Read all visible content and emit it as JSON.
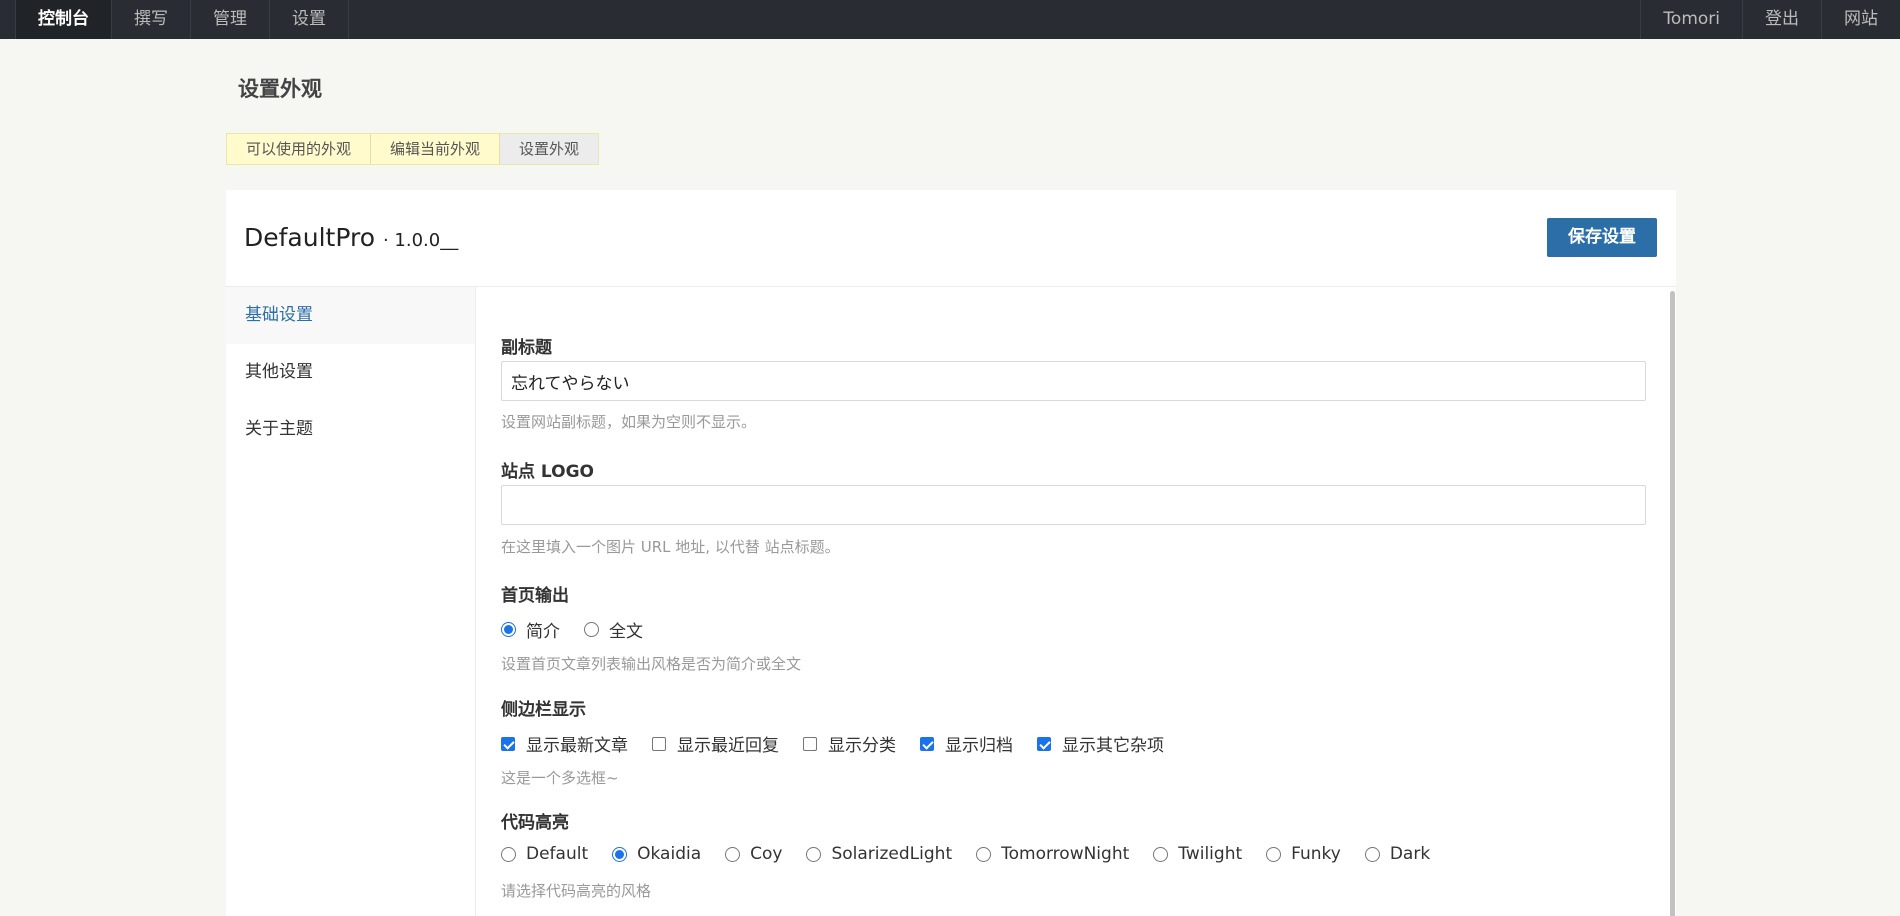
{
  "nav": {
    "left": [
      "控制台",
      "撰写",
      "管理",
      "设置"
    ],
    "right": [
      "Tomori",
      "登出",
      "网站"
    ]
  },
  "page": {
    "title": "设置外观"
  },
  "tabs": [
    "可以使用的外观",
    "编辑当前外观",
    "设置外观"
  ],
  "theme": {
    "name": "DefaultPro",
    "version": "· 1.0.0__"
  },
  "save_label": "保存设置",
  "sidebar": [
    "基础设置",
    "其他设置",
    "关于主题"
  ],
  "fields": {
    "subtitle": {
      "label": "副标题",
      "value": "忘れてやらない",
      "hint": "设置网站副标题，如果为空则不显示。"
    },
    "logo": {
      "label": "站点 LOGO",
      "value": "",
      "hint": "在这里填入一个图片 URL 地址, 以代替 站点标题。"
    },
    "home_output": {
      "label": "首页输出",
      "options": [
        "简介",
        "全文"
      ],
      "selected": "简介",
      "hint": "设置首页文章列表输出风格是否为简介或全文"
    },
    "sidebar_display": {
      "label": "侧边栏显示",
      "options": [
        "显示最新文章",
        "显示最近回复",
        "显示分类",
        "显示归档",
        "显示其它杂项"
      ],
      "checked": [
        true,
        false,
        false,
        true,
        true
      ],
      "hint": "这是一个多选框~"
    },
    "code_highlight": {
      "label": "代码高亮",
      "options": [
        "Default",
        "Okaidia",
        "Coy",
        "SolarizedLight",
        "TomorrowNight",
        "Twilight",
        "Funky",
        "Dark"
      ],
      "selected": "Okaidia",
      "hint": "请选择代码高亮的风格"
    }
  },
  "colors": {
    "nav_bg": "#292d33",
    "accent": "#2c6fa8",
    "tab_bg": "#fffbcc",
    "page_bg": "#f6f6f3"
  }
}
